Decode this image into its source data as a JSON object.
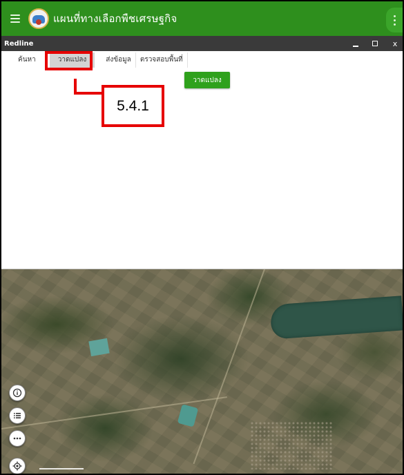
{
  "app": {
    "title": "แผนที่ทางเลือกพืชเศรษฐกิจ",
    "header_color": "#2e8f1d"
  },
  "window": {
    "title": "Redline",
    "controls": [
      "minimize-icon",
      "maximize-icon",
      "close-icon"
    ],
    "close_label": "x"
  },
  "tabs": [
    {
      "label": "ค้นหา"
    },
    {
      "label": "วาดแปลง",
      "selected": true
    },
    {
      "label": "ส่งข้อมูล"
    },
    {
      "label": "ตรวจสอบพื้นที่"
    }
  ],
  "draw_panel": {
    "button_label": "วาดแปลง",
    "button_color": "#2fa11c"
  },
  "annotation": {
    "label": "5.4.1",
    "color": "#e60000"
  },
  "map": {
    "controls": [
      "info-icon",
      "layer-list-icon",
      "more-icon",
      "locate-icon"
    ]
  }
}
